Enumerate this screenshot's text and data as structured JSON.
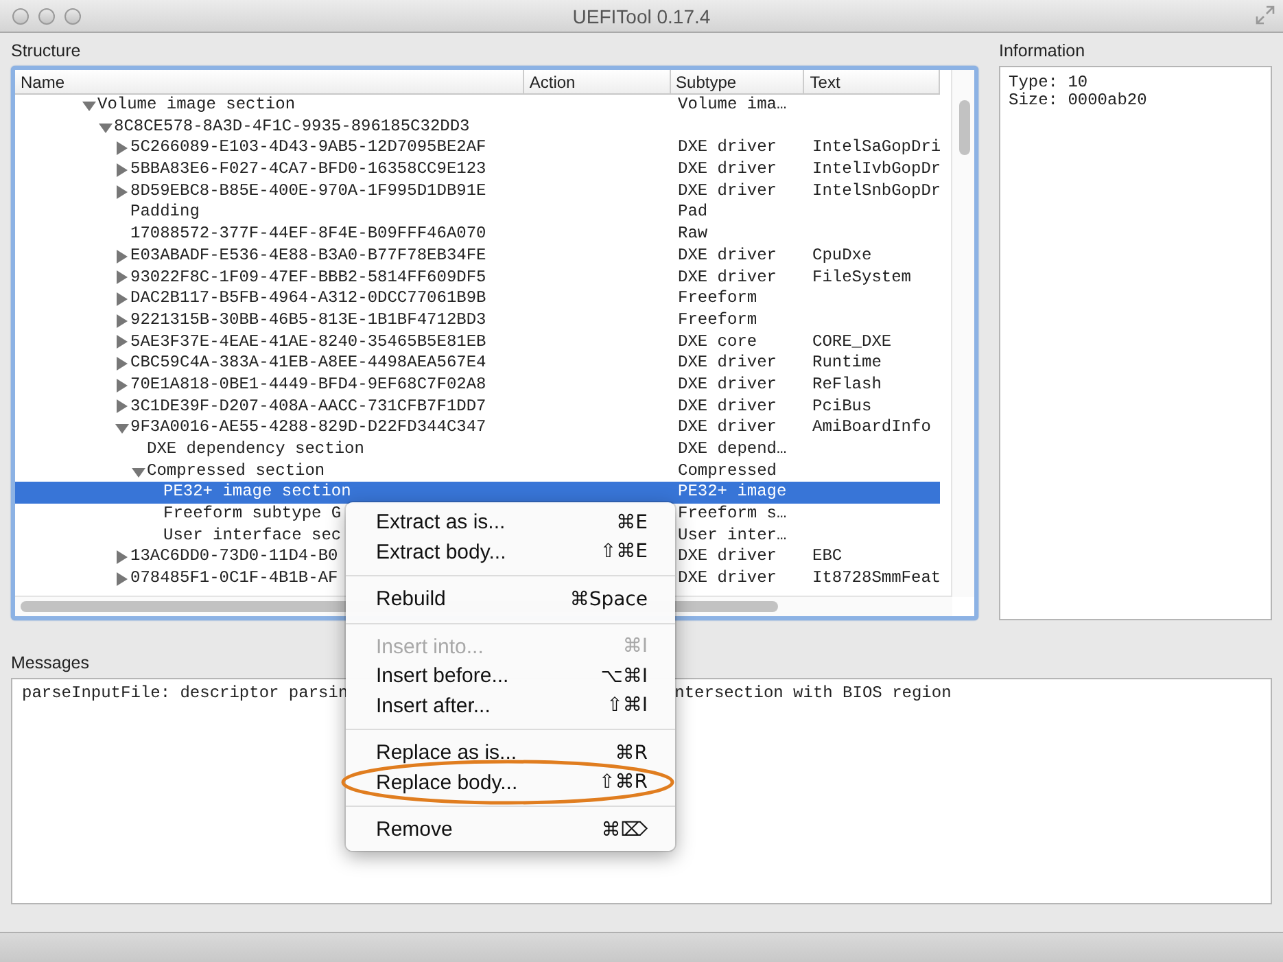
{
  "window": {
    "title": "UEFITool 0.17.4"
  },
  "structure": {
    "title": "Structure",
    "columns": [
      "Name",
      "Action",
      "Subtype",
      "Text"
    ],
    "rows": [
      {
        "name": "Volume image section",
        "subtype": "Volume ima…",
        "expanded": true,
        "selected": false,
        "children": [
          {
            "name": "8C8CE578-8A3D-4F1C-9935-896185C32DD3",
            "expanded": true,
            "selected": false,
            "children": [
              {
                "name": "5C266089-E103-4D43-9AB5-12D7095BE2AF",
                "subtype": "DXE driver",
                "text": "IntelSaGopDri",
                "expanded": false,
                "selected": false
              },
              {
                "name": "5BBA83E6-F027-4CA7-BFD0-16358CC9E123",
                "subtype": "DXE driver",
                "text": "IntelIvbGopDr",
                "expanded": false,
                "selected": false
              },
              {
                "name": "8D59EBC8-B85E-400E-970A-1F995D1DB91E",
                "subtype": "DXE driver",
                "text": "IntelSnbGopDr",
                "expanded": false,
                "selected": false
              },
              {
                "name": "Padding",
                "subtype": "Pad",
                "selected": false
              },
              {
                "name": "17088572-377F-44EF-8F4E-B09FFF46A070",
                "subtype": "Raw",
                "selected": false
              },
              {
                "name": "E03ABADF-E536-4E88-B3A0-B77F78EB34FE",
                "subtype": "DXE driver",
                "text": "CpuDxe",
                "expanded": false,
                "selected": false
              },
              {
                "name": "93022F8C-1F09-47EF-BBB2-5814FF609DF5",
                "subtype": "DXE driver",
                "text": "FileSystem",
                "expanded": false,
                "selected": false
              },
              {
                "name": "DAC2B117-B5FB-4964-A312-0DCC77061B9B",
                "subtype": "Freeform",
                "expanded": false,
                "selected": false
              },
              {
                "name": "9221315B-30BB-46B5-813E-1B1BF4712BD3",
                "subtype": "Freeform",
                "expanded": false,
                "selected": false
              },
              {
                "name": "5AE3F37E-4EAE-41AE-8240-35465B5E81EB",
                "subtype": "DXE core",
                "text": "CORE_DXE",
                "expanded": false,
                "selected": false
              },
              {
                "name": "CBC59C4A-383A-41EB-A8EE-4498AEA567E4",
                "subtype": "DXE driver",
                "text": "Runtime",
                "expanded": false,
                "selected": false
              },
              {
                "name": "70E1A818-0BE1-4449-BFD4-9EF68C7F02A8",
                "subtype": "DXE driver",
                "text": "ReFlash",
                "expanded": false,
                "selected": false
              },
              {
                "name": "3C1DE39F-D207-408A-AACC-731CFB7F1DD7",
                "subtype": "DXE driver",
                "text": "PciBus",
                "expanded": false,
                "selected": false
              },
              {
                "name": "9F3A0016-AE55-4288-829D-D22FD344C347",
                "subtype": "DXE driver",
                "text": "AmiBoardInfo",
                "expanded": true,
                "selected": false,
                "children": [
                  {
                    "name": "DXE dependency section",
                    "subtype": "DXE depend…",
                    "selected": false
                  },
                  {
                    "name": "Compressed section",
                    "subtype": "Compressed",
                    "expanded": true,
                    "selected": false,
                    "children": [
                      {
                        "name": "PE32+ image section",
                        "subtype": "PE32+ image",
                        "selected": true
                      },
                      {
                        "name": "Freeform subtype G",
                        "subtype": "Freeform s…",
                        "selected": false
                      },
                      {
                        "name": "User interface sec",
                        "subtype": "User inter…",
                        "selected": false
                      }
                    ]
                  }
                ]
              },
              {
                "name": "13AC6DD0-73D0-11D4-B0",
                "subtype": "DXE driver",
                "text": "EBC",
                "expanded": false,
                "selected": false
              },
              {
                "name": "078485F1-0C1F-4B1B-AF",
                "subtype": "DXE driver",
                "text": "It8728SmmFeat",
                "expanded": false,
                "selected": false
              }
            ]
          }
        ]
      }
    ]
  },
  "information": {
    "title": "Information",
    "lines": [
      "Type: 10",
      "Size: 0000ab20"
    ]
  },
  "messages": {
    "title": "Messages",
    "lines": [
      {
        "parts": [
          "parseInputFile: descriptor parsin",
          "ntersection with BIOS region"
        ]
      }
    ]
  },
  "context_menu": {
    "groups": [
      [
        {
          "label": "Extract as is...",
          "shortcut": "⌘E",
          "disabled": false,
          "annotated": false
        },
        {
          "label": "Extract body...",
          "shortcut": "⇧⌘E",
          "disabled": false,
          "annotated": false
        }
      ],
      [
        {
          "label": "Rebuild",
          "shortcut": "⌘Space",
          "disabled": false,
          "annotated": false
        }
      ],
      [
        {
          "label": "Insert into...",
          "shortcut": "⌘I",
          "disabled": true,
          "annotated": false
        },
        {
          "label": "Insert before...",
          "shortcut": "⌥⌘I",
          "disabled": false,
          "annotated": false
        },
        {
          "label": "Insert after...",
          "shortcut": "⇧⌘I",
          "disabled": false,
          "annotated": false
        }
      ],
      [
        {
          "label": "Replace as is...",
          "shortcut": "⌘R",
          "disabled": false,
          "annotated": false
        },
        {
          "label": "Replace body...",
          "shortcut": "⇧⌘R",
          "disabled": false,
          "annotated": true
        }
      ],
      [
        {
          "label": "Remove",
          "shortcut": "⌘⌦",
          "disabled": false,
          "annotated": false
        }
      ]
    ]
  }
}
